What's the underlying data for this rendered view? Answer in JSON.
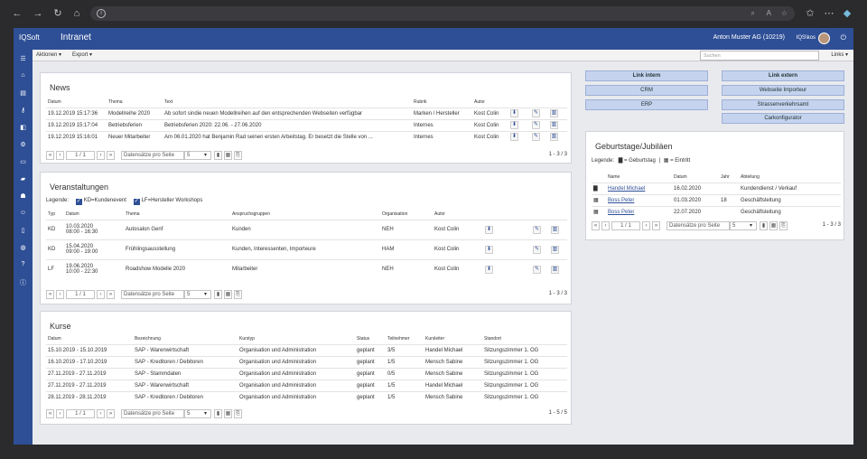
{
  "app": {
    "brand": "IQSoft",
    "title": "Intranet",
    "company": "Anton Muster AG (10219)",
    "user": "IQS\\kos"
  },
  "toolbar": {
    "actions": "Aktionen ▾",
    "export": "Export ▾",
    "search_placeholder": "Suchen",
    "links": "Links ▾"
  },
  "news": {
    "title": "News",
    "columns": [
      "Datum",
      "Thema",
      "Text",
      "Rubrik",
      "Autor"
    ],
    "rows": [
      [
        "19.12.2019 15:17:36",
        "Modellreihe 2020",
        "Ab sofort sindie neuen Modellreihen auf den entsprechenden Webseiten verfügbar",
        "Marken / Hersteller",
        "Kost Colin"
      ],
      [
        "19.12.2019 15:17:04",
        "Betriebsferien",
        "Betriebsferien 2020: 22.06. - 27.06.2020",
        "Internes",
        "Kost Colin"
      ],
      [
        "19.12.2019 15:16:01",
        "Neuer Mitarbeiter",
        "Am 06.01.2020 hat Benjamin Rad seinen ersten Arbeitstag. Er besetzt die Stelle von ...",
        "Internes",
        "Kost Colin"
      ]
    ],
    "pager": {
      "page": "1 / 1",
      "per_page_label": "Datensätze pro Seite",
      "per_page": "5",
      "info": "1 - 3 / 3"
    }
  },
  "events": {
    "title": "Veranstaltungen",
    "legend_label": "Legende:",
    "legend_items": [
      "KD=Kundenevent",
      "LF=Hersteller Workshops"
    ],
    "columns": [
      "Typ",
      "Datum",
      "Thema",
      "Anspruchsgruppen",
      "Organisation",
      "Autor"
    ],
    "rows": [
      [
        "KD",
        "10.03.2020",
        "08:00 - 16:30",
        "Autosalon Genf",
        "Kunden",
        "NEH",
        "Kost Colin"
      ],
      [
        "KD",
        "15.04.2020",
        "09:00 - 19:00",
        "Frühlingsausstellung",
        "Kunden, Interessenten, Importeure",
        "HAM",
        "Kost Colin"
      ],
      [
        "LF",
        "19.06.2020",
        "10:00 - 22:30",
        "Roadshow Modelle 2020",
        "Mitarbeiter",
        "NEH",
        "Kost Colin"
      ]
    ],
    "pager": {
      "page": "1 / 1",
      "per_page_label": "Datensätze pro Seite",
      "per_page": "5",
      "info": "1 - 3 / 3"
    }
  },
  "courses": {
    "title": "Kurse",
    "columns": [
      "Datum",
      "Bezeichnung",
      "Kurstyp",
      "Status",
      "Teilnehmer",
      "Kursleiter",
      "Standort"
    ],
    "rows": [
      [
        "15.10.2019 - 15.10.2019",
        "SAP - Warenwirtschaft",
        "Organisation und Administration",
        "geplant",
        "3/5",
        "Handel Michael",
        "Sitzungszimmer 1. OG"
      ],
      [
        "16.10.2019 - 17.10.2019",
        "SAP - Kreditoren / Debitoren",
        "Organisation und Administration",
        "geplant",
        "1/5",
        "Mensch Sabine",
        "Sitzungszimmer 1. OG"
      ],
      [
        "27.11.2019 - 27.11.2019",
        "SAP - Stammdaten",
        "Organisation und Administration",
        "geplant",
        "0/5",
        "Mensch Sabine",
        "Sitzungszimmer 1. OG"
      ],
      [
        "27.11.2019 - 27.11.2019",
        "SAP - Warenwirtschaft",
        "Organisation und Administration",
        "geplant",
        "1/5",
        "Handel Michael",
        "Sitzungszimmer 1. OG"
      ],
      [
        "28.11.2019 - 28.11.2019",
        "SAP - Kreditoren / Debitoren",
        "Organisation und Administration",
        "geplant",
        "1/5",
        "Mensch Sabine",
        "Sitzungszimmer 1. OG"
      ]
    ],
    "pager": {
      "page": "1 / 1",
      "per_page_label": "Datensätze pro Seite",
      "per_page": "5",
      "info": "1 - 5 / 5"
    }
  },
  "links": {
    "intern_header": "Link intern",
    "extern_header": "Link extern",
    "intern": [
      "CRM",
      "ERP"
    ],
    "extern": [
      "Webseite Importeur",
      "Strassenverkehrsamt",
      "Carkonfigurator"
    ]
  },
  "birthdays": {
    "title": "Geburtstage/Jubiläen",
    "legend_label": "Legende:",
    "legend_birthday": "= Geburtstag",
    "legend_sep": "|",
    "legend_entry": "= Eintritt",
    "columns": [
      "Name",
      "Datum",
      "Jahr",
      "Abteilung"
    ],
    "rows": [
      [
        "Handel Michael",
        "16.02.2020",
        "",
        "Kundendienst / Verkauf"
      ],
      [
        "Boss Peter",
        "01.03.2020",
        "18",
        "Geschäftsleitung"
      ],
      [
        "Boss Peter",
        "22.07.2020",
        "",
        "Geschäftsleitung"
      ]
    ],
    "pager": {
      "page": "1 / 1",
      "per_page_label": "Datensätze pro Seite",
      "per_page": "5",
      "info": "1 - 3 / 3"
    }
  }
}
